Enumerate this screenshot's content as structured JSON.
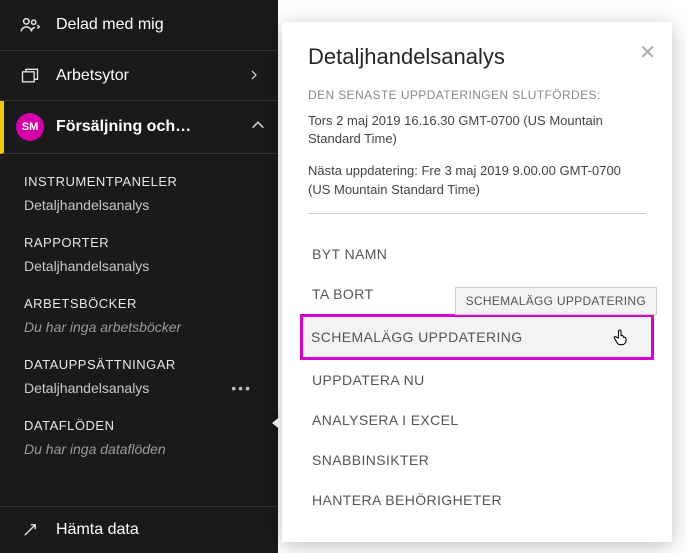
{
  "sidebar": {
    "shared": "Delad med mig",
    "workspaces": "Arbetsytor",
    "workspace": {
      "badge": "SM",
      "label": "Försäljning och…"
    },
    "sections": {
      "dashboards": {
        "header": "INSTRUMENTPANELER",
        "entry": "Detaljhandelsanalys"
      },
      "reports": {
        "header": "RAPPORTER",
        "entry": "Detaljhandelsanalys"
      },
      "workbooks": {
        "header": "ARBETSBÖCKER",
        "entry": "Du har inga arbetsböcker"
      },
      "datasets": {
        "header": "DATAUPPSÄTTNINGAR",
        "entry": "Detaljhandelsanalys"
      },
      "dataflows": {
        "header": "DATAFLÖDEN",
        "entry": "Du har inga dataflöden"
      }
    },
    "getdata": "Hämta data"
  },
  "popup": {
    "title": "Detaljhandelsanalys",
    "meta_label": "DEN SENASTE UPPDATERINGEN SLUTFÖRDES:",
    "last_update": "Tors 2 maj 2019 16.16.30 GMT-0700 (US Mountain Standard Time)",
    "next_update": "Nästa uppdatering: Fre 3 maj 2019 9.00.00 GMT-0700 (US Mountain Standard Time)",
    "tooltip": "SCHEMALÄGG UPPDATERING",
    "menu": {
      "rename": "BYT NAMN",
      "delete": "TA BORT",
      "schedule": "SCHEMALÄGG UPPDATERING",
      "refresh_now": "UPPDATERA NU",
      "analyze_excel": "ANALYSERA I EXCEL",
      "quick_insights": "SNABBINSIKTER",
      "manage_perms": "HANTERA BEHÖRIGHETER"
    }
  }
}
